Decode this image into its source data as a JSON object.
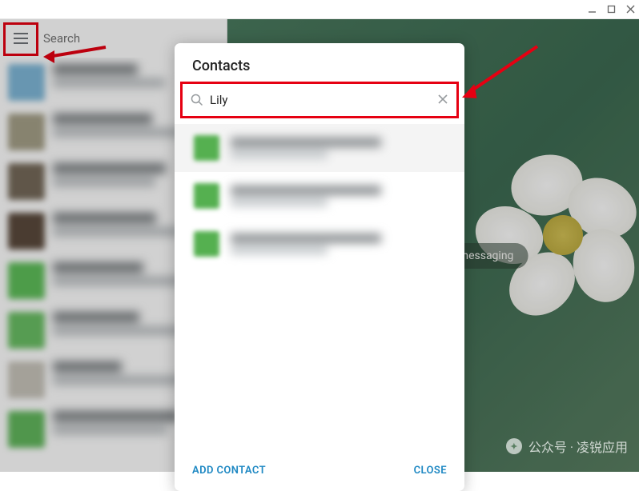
{
  "window": {
    "minimize": "_",
    "maximize": "□",
    "close": "×"
  },
  "left": {
    "search_placeholder": "Search"
  },
  "main": {
    "messaging_label": "Select a chat to start messaging"
  },
  "modal": {
    "title": "Contacts",
    "search_value": "Lily",
    "add_contact": "ADD CONTACT",
    "close": "CLOSE"
  },
  "chats": [
    {
      "avatar_bg": "#7fb8d8"
    },
    {
      "avatar_bg": "#a5a088"
    },
    {
      "avatar_bg": "#766a5a"
    },
    {
      "avatar_bg": "#5b4a3c"
    },
    {
      "avatar_bg": "#5fbf5a"
    },
    {
      "avatar_bg": "#6abf64"
    },
    {
      "avatar_bg": "#c8c5bb"
    },
    {
      "avatar_bg": "#62b85d"
    }
  ],
  "results": [
    {
      "bg": "#55b050",
      "selected": true
    },
    {
      "bg": "#55b050",
      "selected": false
    },
    {
      "bg": "#55b050",
      "selected": false
    }
  ],
  "watermark": {
    "label": "公众号 · 凌锐应用"
  },
  "colors": {
    "highlight": "#e60012",
    "accent": "#1e88c3"
  }
}
